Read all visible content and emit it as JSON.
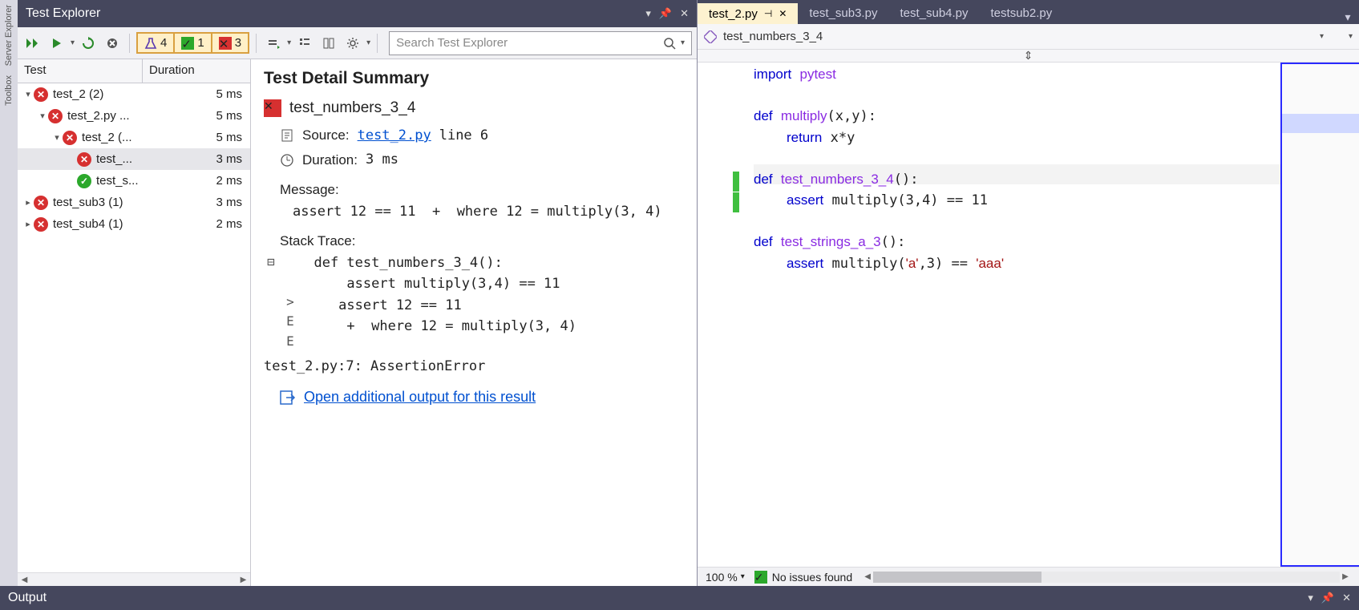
{
  "sideTabs": [
    "Server Explorer",
    "Toolbox"
  ],
  "testExplorer": {
    "title": "Test Explorer",
    "filters": {
      "flask": "4",
      "pass": "1",
      "fail": "3"
    },
    "searchPlaceholder": "Search Test Explorer",
    "columns": {
      "name": "Test",
      "duration": "Duration"
    },
    "tree": [
      {
        "depth": 0,
        "expand": "▾",
        "status": "fail",
        "label": "test_2  (2)",
        "dur": "5 ms"
      },
      {
        "depth": 1,
        "expand": "▾",
        "status": "fail",
        "label": "test_2.py  ...",
        "dur": "5 ms"
      },
      {
        "depth": 2,
        "expand": "▾",
        "status": "fail",
        "label": "test_2  (...",
        "dur": "5 ms"
      },
      {
        "depth": 3,
        "expand": "",
        "status": "fail",
        "label": "test_...",
        "dur": "3 ms",
        "sel": true
      },
      {
        "depth": 3,
        "expand": "",
        "status": "pass",
        "label": "test_s...",
        "dur": "2 ms"
      },
      {
        "depth": 0,
        "expand": "▸",
        "status": "fail",
        "label": "test_sub3  (1)",
        "dur": "3 ms"
      },
      {
        "depth": 0,
        "expand": "▸",
        "status": "fail",
        "label": "test_sub4  (1)",
        "dur": "2 ms"
      }
    ]
  },
  "detail": {
    "heading": "Test Detail Summary",
    "testName": "test_numbers_3_4",
    "sourceLabel": "Source:",
    "sourceLink": "test_2.py",
    "sourceLine": "line 6",
    "durationLabel": "Duration:",
    "durationValue": "3 ms",
    "messageLabel": "Message:",
    "messageBody": "assert 12 == 11  +  where 12 = multiply(3, 4)",
    "stackLabel": "Stack Trace:",
    "stackGutter": " \n \n>\nE\nE",
    "stackBody": "  def test_numbers_3_4():\n      assert multiply(3,4) == 11\n     assert 12 == 11\n      +  where 12 = multiply(3, 4)",
    "finalLine": "test_2.py:7: AssertionError",
    "openLink": "Open additional output for this result"
  },
  "editor": {
    "tabs": [
      {
        "label": "test_2.py",
        "active": true,
        "pinned": true
      },
      {
        "label": "test_sub3.py"
      },
      {
        "label": "test_sub4.py"
      },
      {
        "label": "testsub2.py"
      }
    ],
    "navSymbol": "test_numbers_3_4",
    "zoom": "100 %",
    "issues": "No issues found"
  },
  "output": {
    "title": "Output"
  }
}
